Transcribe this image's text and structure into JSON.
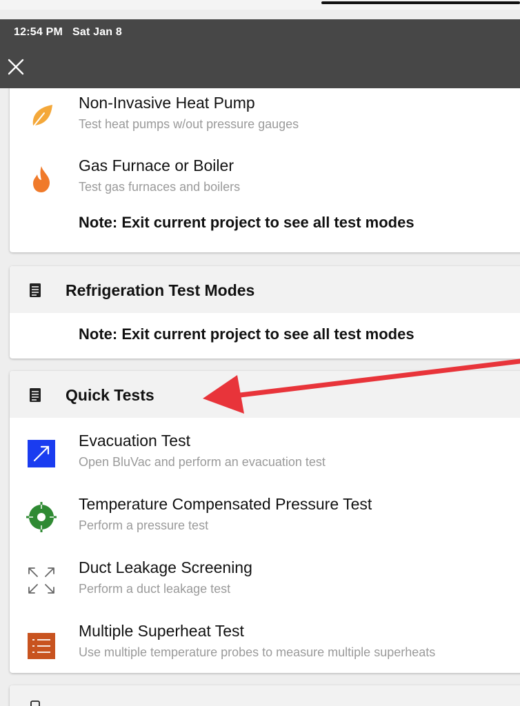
{
  "status": {
    "time": "12:54 PM",
    "date": "Sat Jan 8"
  },
  "card1": {
    "items": [
      {
        "title": "Non-Invasive Heat Pump",
        "subtitle": "Test heat pumps w/out pressure gauges",
        "icon": "leaf-icon",
        "color": "#f4a83a"
      },
      {
        "title": "Gas Furnace or Boiler",
        "subtitle": "Test gas furnaces and boilers",
        "icon": "flame-icon",
        "color": "#f07a2a"
      }
    ],
    "note": "Note: Exit current project to see all test modes"
  },
  "refrigeration": {
    "title": "Refrigeration Test Modes",
    "note": "Note: Exit current project to see all test modes"
  },
  "quick_tests": {
    "title": "Quick Tests",
    "items": [
      {
        "title": "Evacuation Test",
        "subtitle": "Open BluVac and perform an evacuation test",
        "icon": "evacuation-icon",
        "color": "#1a3cf0"
      },
      {
        "title": "Temperature Compensated Pressure Test",
        "subtitle": "Perform a pressure test",
        "icon": "target-icon",
        "color": "#2f8a33"
      },
      {
        "title": "Duct Leakage Screening",
        "subtitle": "Perform a duct leakage test",
        "icon": "expand-arrows-icon",
        "color": "#666666"
      },
      {
        "title": "Multiple Superheat Test",
        "subtitle": "Use multiple temperature probes to measure multiple superheats",
        "icon": "list-icon",
        "color": "#c8531f"
      }
    ]
  },
  "colors": {
    "status_bar": "#474747",
    "arrow": "#e8343a",
    "header_bg": "#f2f2f2"
  }
}
